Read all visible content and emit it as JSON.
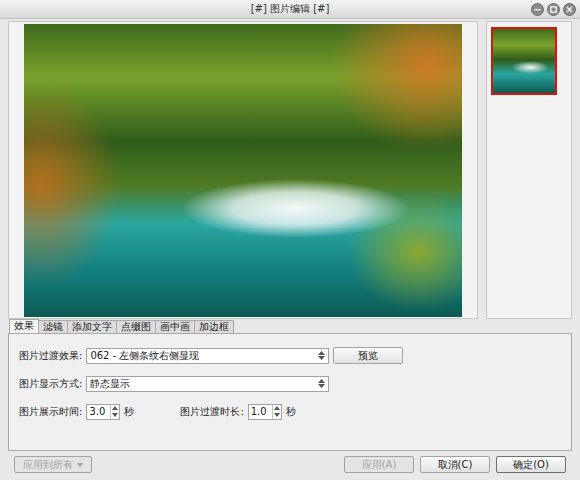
{
  "window": {
    "title": "[#] 图片编辑 [#]"
  },
  "thumbnails": [
    {
      "selected": true
    }
  ],
  "tabs": [
    {
      "label": "效果",
      "selected": true
    },
    {
      "label": "滤镜",
      "selected": false
    },
    {
      "label": "添加文字",
      "selected": false
    },
    {
      "label": "点缀图",
      "selected": false
    },
    {
      "label": "画中画",
      "selected": false
    },
    {
      "label": "加边框",
      "selected": false
    }
  ],
  "effect_panel": {
    "transition": {
      "label": "图片过渡效果:",
      "value": "062 - 左侧条纹右侧显现",
      "button": "预览"
    },
    "display": {
      "label": "图片显示方式:",
      "value": "静态显示"
    },
    "durations": [
      {
        "label": "图片展示时间:",
        "value": "3.0",
        "unit": "秒"
      },
      {
        "label": "图片过渡时长:",
        "value": "1.0",
        "unit": "秒"
      }
    ]
  },
  "footer": {
    "apply_all": {
      "label": "应用到所有",
      "disabled": true
    },
    "buttons": [
      {
        "label": "应用(A)",
        "disabled": true,
        "default": false
      },
      {
        "label": "取消(C)",
        "disabled": false,
        "default": false
      },
      {
        "label": "确定(O)",
        "disabled": false,
        "default": true
      }
    ]
  }
}
